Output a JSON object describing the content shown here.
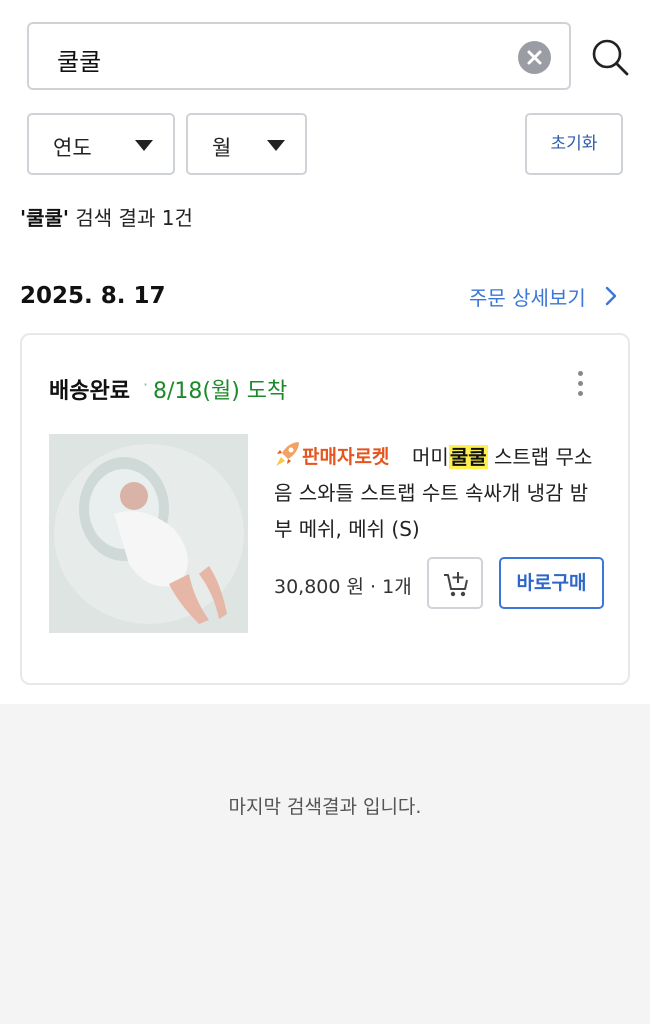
{
  "search": {
    "query": "쿨쿨"
  },
  "filters": {
    "year_label": "연도",
    "month_label": "월",
    "reset_label": "초기화"
  },
  "results": {
    "query_quoted": "'쿨쿨'",
    "suffix": " 검색 결과 1건"
  },
  "order": {
    "date": "2025. 8. 17",
    "detail_link": "주문 상세보기",
    "status": "배송완료",
    "separator": "·",
    "arrival": "8/18(월) 도착",
    "rocket_label": "판매자로켓",
    "title_prefix": "머미",
    "title_highlight": "쿨쿨",
    "title_rest": " 스트랩 무소음 스와들 스트랩 수트 속싸개 냉감 밤부 메쉬, 메쉬 (S)",
    "price": "30,800 원 · 1개",
    "buy_now": "바로구매"
  },
  "footer": {
    "message": "마지막 검색결과 입니다."
  },
  "colors": {
    "accent_blue": "#3b77d8",
    "arrival_green": "#1d8a2a",
    "rocket_orange": "#e5551d",
    "highlight": "#fff04d"
  },
  "icons": [
    "clear-icon",
    "search-icon",
    "chevron-down-icon",
    "chevron-right-icon",
    "more-vertical-icon",
    "rocket-icon",
    "add-to-cart-icon"
  ]
}
